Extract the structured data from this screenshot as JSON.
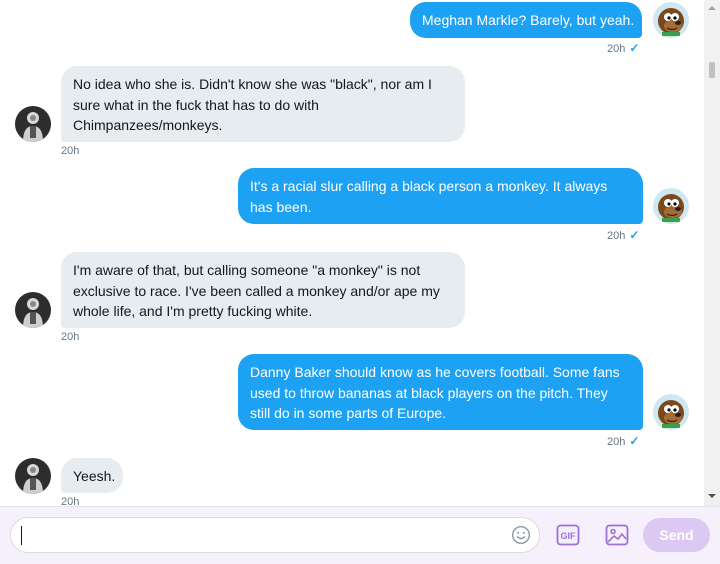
{
  "conversation": {
    "messages": [
      {
        "direction": "outgoing",
        "text": "Meghan Markle? Barely, but yeah.",
        "time": "20h",
        "status": "sent"
      },
      {
        "direction": "incoming",
        "text": "No idea who she is. Didn't know she was \"black\", nor am I sure what in the fuck that has to do with Chimpanzees/monkeys.",
        "time": "20h"
      },
      {
        "direction": "outgoing",
        "text": "It's a racial slur calling a black person a monkey. It always has been.",
        "time": "20h",
        "status": "sent"
      },
      {
        "direction": "incoming",
        "text": "I'm aware of that, but calling someone \"a monkey\" is not exclusive to race. I've been called a monkey and/or ape my whole life, and I'm pretty fucking white.",
        "time": "20h"
      },
      {
        "direction": "outgoing",
        "text": "Danny Baker should know as he covers football. Some fans used to throw bananas at black players on the pitch. They still do in some parts of Europe.",
        "time": "20h",
        "status": "sent"
      },
      {
        "direction": "incoming",
        "text": "Yeesh.",
        "time": "20h"
      }
    ],
    "check_glyph": "✓"
  },
  "composer": {
    "input_value": "",
    "input_placeholder": "",
    "send_label": "Send",
    "gif_label": "GIF"
  },
  "icons": {
    "own_avatar": "cartoon-dog-avatar",
    "other_avatar": "dark-figure-avatar",
    "emoji": "smiley-icon",
    "gif": "gif-icon",
    "image": "image-icon",
    "scroll_up": "chevron-up-icon",
    "scroll_down": "chevron-down-icon"
  },
  "colors": {
    "outgoing_bubble": "#1da1f2",
    "incoming_bubble": "#e6ecf0",
    "accent_purple": "#9f6fd6",
    "send_disabled": "#dcc9f3",
    "composer_bg": "#f5f0fb"
  }
}
